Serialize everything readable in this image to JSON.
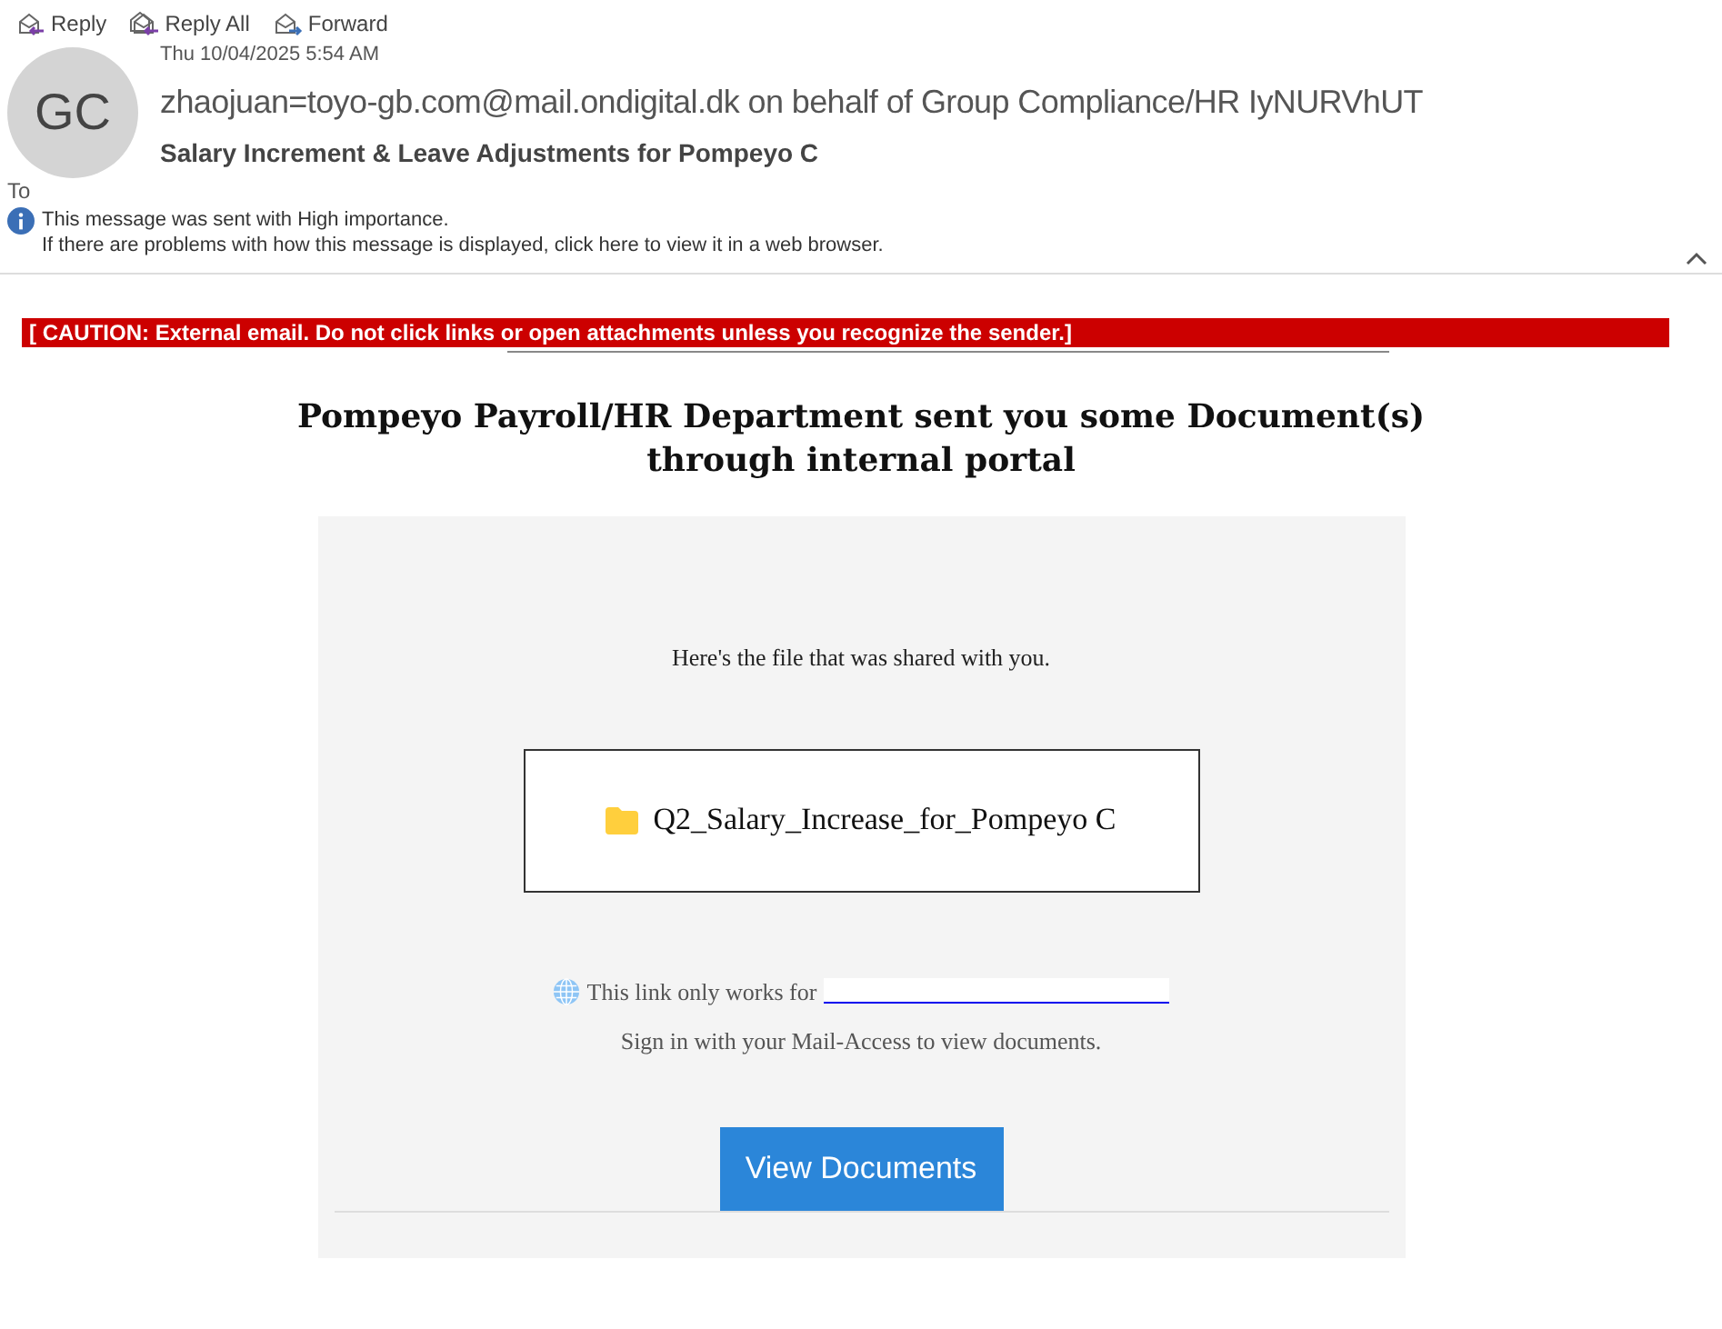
{
  "toolbar": [
    {
      "label": "Reply",
      "kind": "reply"
    },
    {
      "label": "Reply All",
      "kind": "replyall"
    },
    {
      "label": "Forward",
      "kind": "forward"
    }
  ],
  "header": {
    "avatar": "GC",
    "date": "Thu 10/04/2025 5:54 AM",
    "sender": "zhaojuan=toyo-gb.com@mail.ondigital.dk on behalf of Group Compliance/HR IyNURVhUT",
    "subject": "Salary Increment & Leave Adjustments for Pompeyo C",
    "to_label": "To",
    "importance": "This message was sent with High importance.",
    "display_note": "If there are problems with how this message is displayed, click here to view it in a web browser."
  },
  "body": {
    "caution": "[ CAUTION: External email. Do not click links or open attachments unless you recognize the sender.]",
    "heading": "Pompeyo Payroll/HR Department sent you some Document(s) through internal portal",
    "intro": "Here's the file that was shared with you.",
    "file_name": "Q2_Salary_Increase_for_Pompeyo C",
    "link_note": "This link only works for",
    "sign_in": "Sign in with your Mail-Access to view documents.",
    "button": "View Documents"
  }
}
